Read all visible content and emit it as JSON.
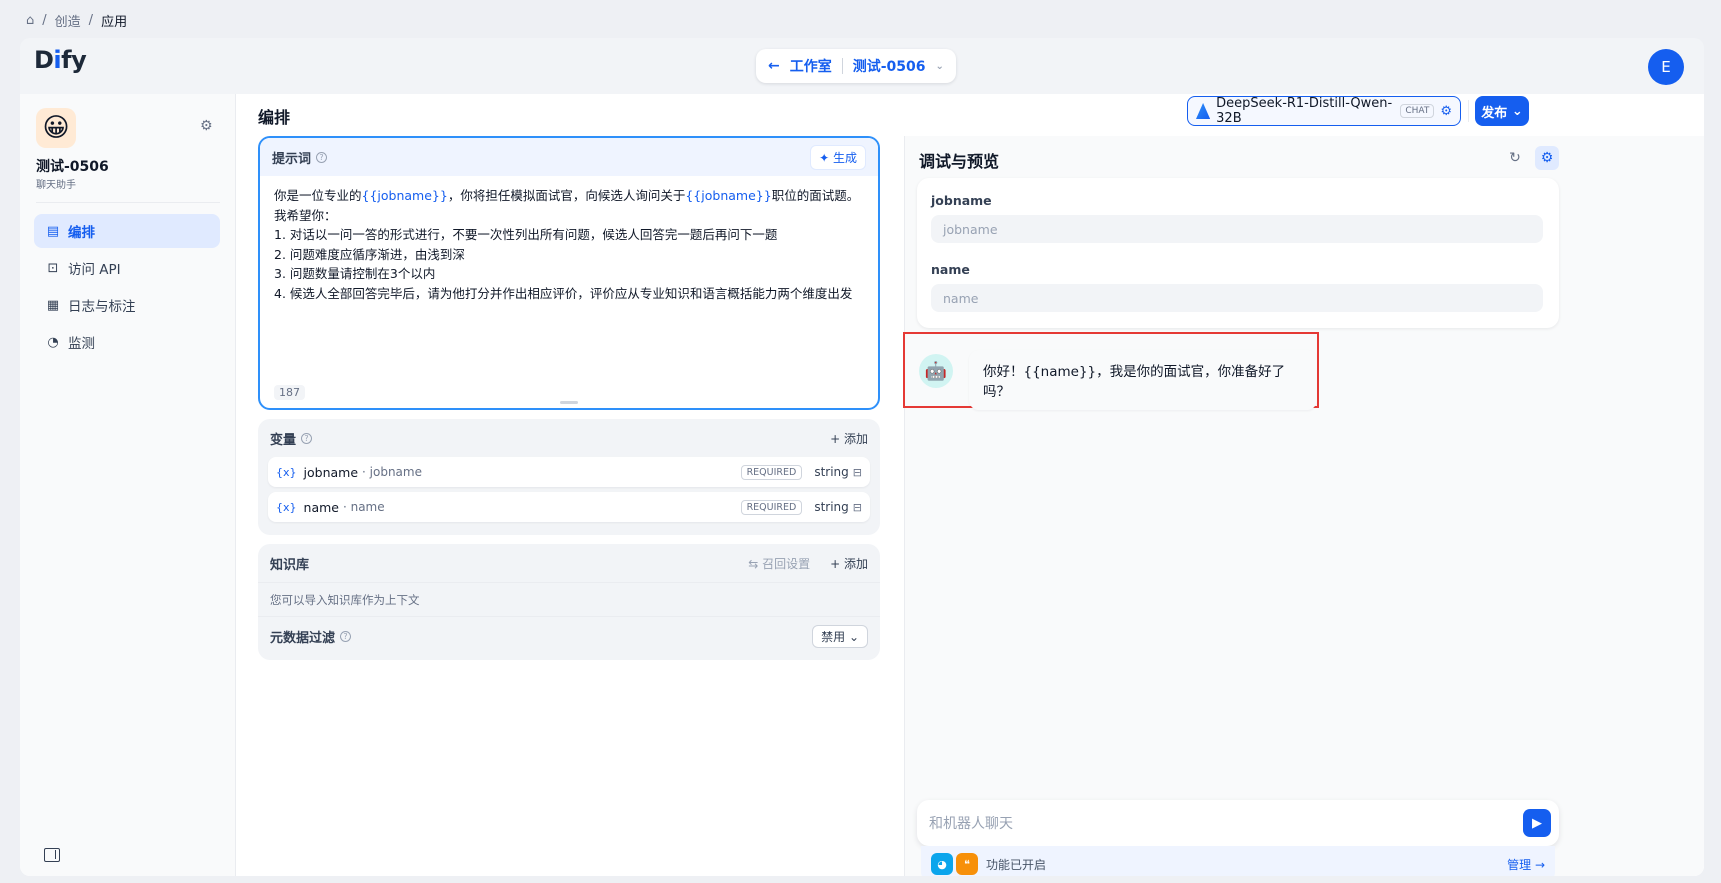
{
  "breadcrumb": {
    "home": "⌂",
    "items": [
      "创造",
      "应用"
    ]
  },
  "header": {
    "logo_pre": "D",
    "logo_i": "i",
    "logo_post": "fy",
    "back_label": "工作室",
    "app_selector": "测试-0506",
    "avatar_initial": "E"
  },
  "sidebar": {
    "app_name": "测试-0506",
    "app_type": "聊天助手",
    "items": [
      {
        "label": "编排",
        "icon": "layout-icon"
      },
      {
        "label": "访问 API",
        "icon": "terminal-icon"
      },
      {
        "label": "日志与标注",
        "icon": "file-icon"
      },
      {
        "label": "监测",
        "icon": "gauge-icon"
      }
    ]
  },
  "main": {
    "title": "编排",
    "model_name": "DeepSeek-R1-Distill-Qwen-32B",
    "model_tag": "CHAT",
    "publish_label": "发布"
  },
  "prompt": {
    "title": "提示词",
    "generate_label": "生成",
    "line1_a": "你是一位专业的",
    "line1_var1": "{{jobname}}",
    "line1_b": "，你将担任模拟面试官，向候选人询问关于",
    "line1_var2": "{{jobname}}",
    "line1_c": "职位的面试题。",
    "lines": [
      "我希望你：",
      "1. 对话以一问一答的形式进行，不要一次性列出所有问题，候选人回答完一题后再问下一题",
      "2. 问题难度应循序渐进，由浅到深",
      "3. 问题数量请控制在3个以内",
      "4. 候选人全部回答完毕后，请为他打分并作出相应评价，评价应从专业知识和语言概括能力两个维度出发"
    ],
    "char_count": "187"
  },
  "variables": {
    "title": "变量",
    "add_label": "+ 添加",
    "rows": [
      {
        "key": "jobname",
        "label": "· jobname",
        "required": "REQUIRED",
        "type": "string"
      },
      {
        "key": "name",
        "label": "· name",
        "required": "REQUIRED",
        "type": "string"
      }
    ]
  },
  "knowledge": {
    "title": "知识库",
    "recall_label": "召回设置",
    "add_label": "+ 添加",
    "hint": "您可以导入知识库作为上下文",
    "metadata_label": "元数据过滤",
    "metadata_value": "禁用"
  },
  "debug": {
    "title": "调试与预览",
    "fields": [
      {
        "label": "jobname",
        "placeholder": "jobname"
      },
      {
        "label": "name",
        "placeholder": "name"
      }
    ],
    "bot_message": "你好！{{name}}，我是你的面试官，你准备好了吗？",
    "chat_placeholder": "和机器人聊天",
    "features_label": "功能已开启",
    "manage_label": "管理 →"
  }
}
